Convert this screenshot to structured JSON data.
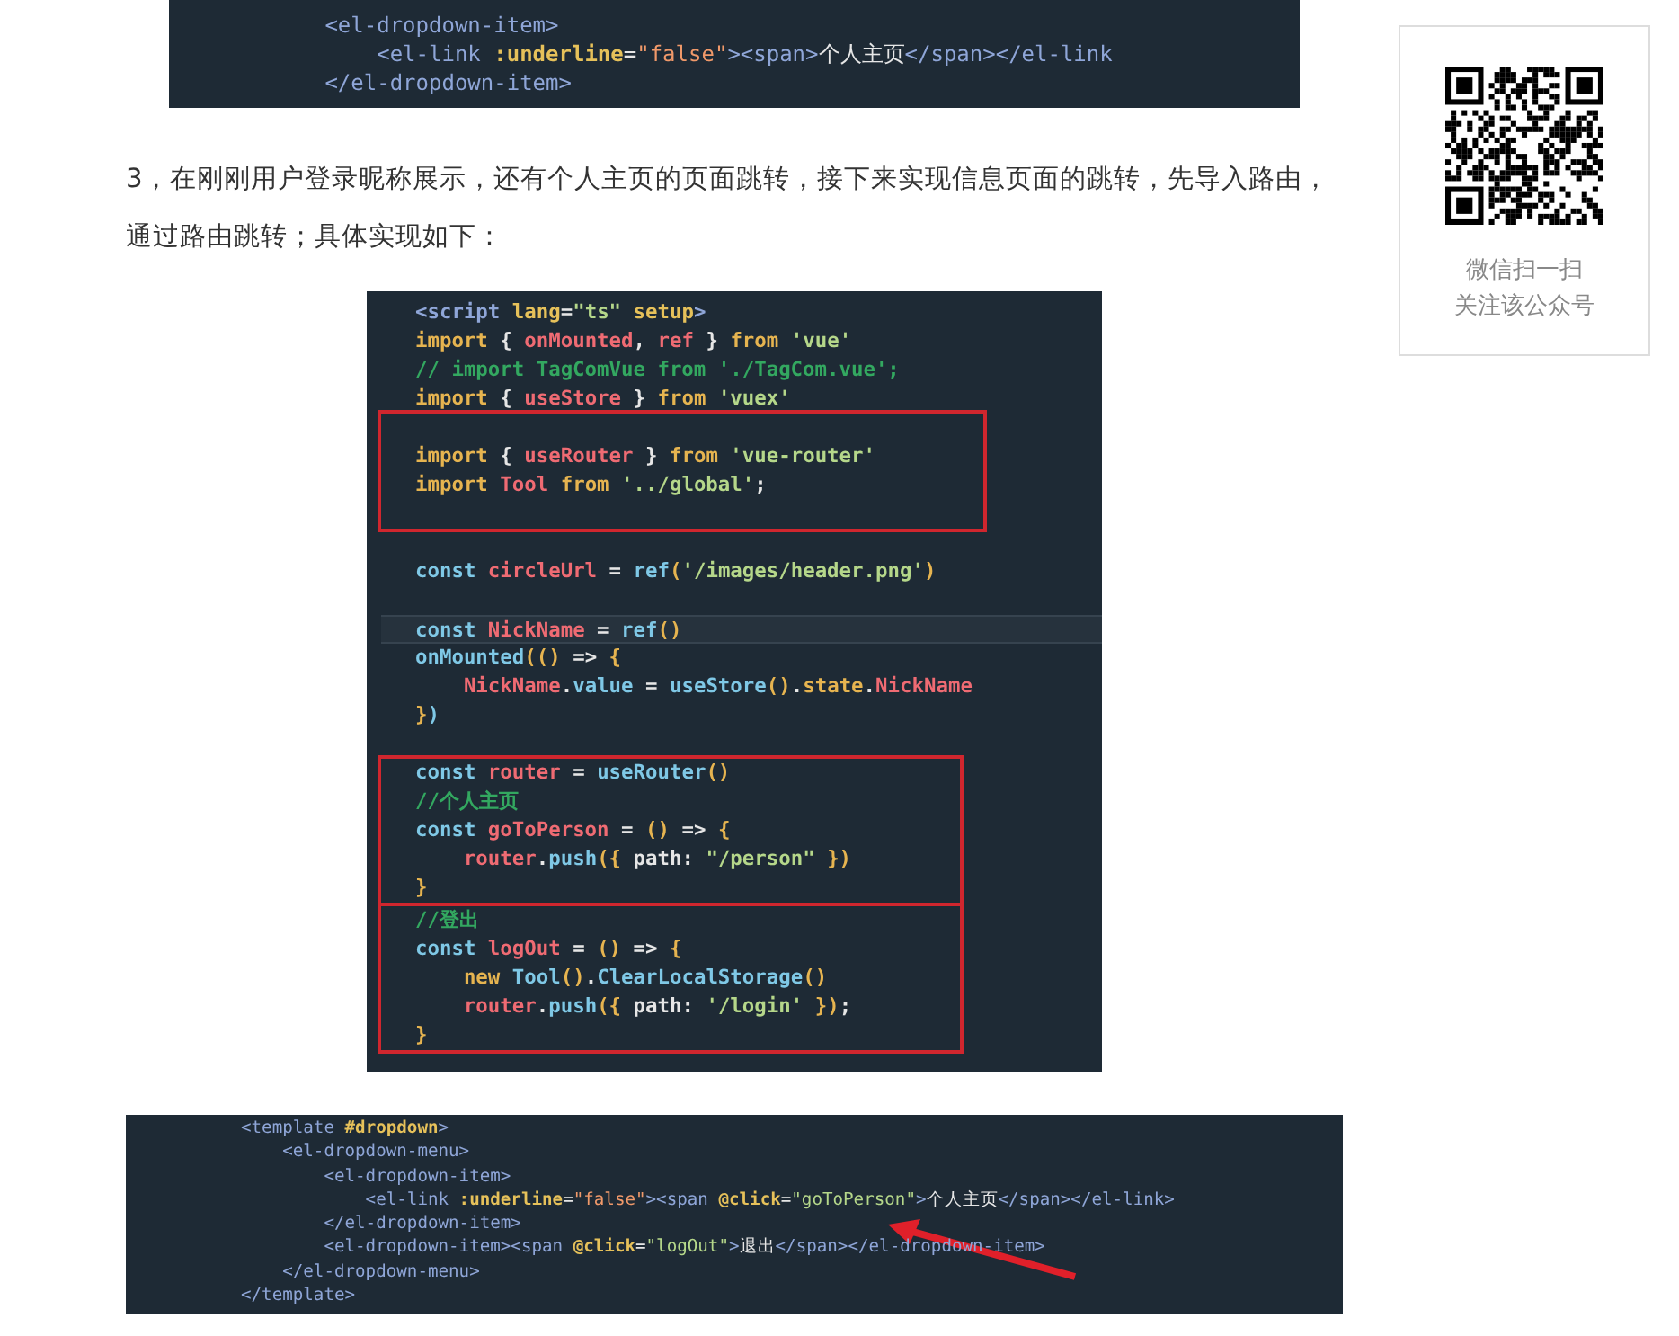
{
  "article": {
    "top_code": {
      "lines": [
        {
          "tokens": [
            {
              "kind": "t",
              "text": "            <el-dropdown-item>"
            }
          ]
        },
        {
          "tokens": [
            {
              "kind": "t",
              "text": "                <el-link "
            },
            {
              "kind": "a",
              "text": ":underline"
            },
            {
              "kind": "p",
              "text": "="
            },
            {
              "kind": "o",
              "text": "\"false\""
            },
            {
              "kind": "t",
              "text": "><span>"
            },
            {
              "kind": "p",
              "text": "个人主页"
            },
            {
              "kind": "t",
              "text": "</span></el-link"
            }
          ]
        },
        {
          "tokens": [
            {
              "kind": "t",
              "text": "            </el-dropdown-item>"
            }
          ]
        }
      ]
    },
    "paragraph": "3，在刚刚用户登录昵称展示，还有个人主页的页面跳转，接下来实现信息页面的跳转，先导入路由，通过路由跳转；具体实现如下：",
    "script_code": {
      "blocks": [
        {
          "boxed": false,
          "lines": [
            {
              "tokens": [
                {
                  "kind": "t",
                  "text": "<script "
                },
                {
                  "kind": "a",
                  "text": "lang"
                },
                {
                  "kind": "p",
                  "text": "="
                },
                {
                  "kind": "s",
                  "text": "\"ts\" "
                },
                {
                  "kind": "a",
                  "text": "setup"
                },
                {
                  "kind": "t",
                  "text": ">"
                }
              ]
            },
            {
              "tokens": [
                {
                  "kind": "k",
                  "text": "import "
                },
                {
                  "kind": "p",
                  "text": "{ "
                },
                {
                  "kind": "v",
                  "text": "onMounted"
                },
                {
                  "kind": "p",
                  "text": ", "
                },
                {
                  "kind": "v",
                  "text": "ref"
                },
                {
                  "kind": "p",
                  "text": " } "
                },
                {
                  "kind": "k",
                  "text": "from "
                },
                {
                  "kind": "s",
                  "text": "'vue'"
                }
              ]
            },
            {
              "tokens": [
                {
                  "kind": "c",
                  "text": "// import TagComVue from './TagCom.vue';"
                }
              ]
            },
            {
              "tokens": [
                {
                  "kind": "k",
                  "text": "import "
                },
                {
                  "kind": "p",
                  "text": "{ "
                },
                {
                  "kind": "v",
                  "text": "useStore"
                },
                {
                  "kind": "p",
                  "text": " } "
                },
                {
                  "kind": "k",
                  "text": "from "
                },
                {
                  "kind": "s",
                  "text": "'vuex'"
                }
              ]
            }
          ]
        },
        {
          "boxed": true,
          "lines": [
            {
              "kind": "blank"
            },
            {
              "tokens": [
                {
                  "kind": "k",
                  "text": "import "
                },
                {
                  "kind": "p",
                  "text": "{ "
                },
                {
                  "kind": "v",
                  "text": "useRouter"
                },
                {
                  "kind": "p",
                  "text": " } "
                },
                {
                  "kind": "k",
                  "text": "from "
                },
                {
                  "kind": "s",
                  "text": "'vue-router'"
                }
              ]
            },
            {
              "tokens": [
                {
                  "kind": "k",
                  "text": "import "
                },
                {
                  "kind": "v",
                  "text": "Tool "
                },
                {
                  "kind": "k",
                  "text": "from "
                },
                {
                  "kind": "s",
                  "text": "'../global'"
                },
                {
                  "kind": "p",
                  "text": ";"
                }
              ]
            },
            {
              "kind": "blank"
            }
          ]
        },
        {
          "boxed": false,
          "lines": [
            {
              "kind": "blank"
            },
            {
              "tokens": [
                {
                  "kind": "f",
                  "text": "const "
                },
                {
                  "kind": "v",
                  "text": "circleUrl"
                },
                {
                  "kind": "p",
                  "text": " = "
                },
                {
                  "kind": "f",
                  "text": "ref"
                },
                {
                  "kind": "k",
                  "text": "("
                },
                {
                  "kind": "s",
                  "text": "'/images/header.png'"
                },
                {
                  "kind": "k",
                  "text": ")"
                }
              ]
            },
            {
              "kind": "blank"
            },
            {
              "current": true,
              "tokens": [
                {
                  "kind": "f",
                  "text": "const "
                },
                {
                  "kind": "v",
                  "text": "NickName"
                },
                {
                  "kind": "p",
                  "text": " = "
                },
                {
                  "kind": "f",
                  "text": "ref"
                },
                {
                  "kind": "k",
                  "text": "()"
                }
              ]
            },
            {
              "tokens": [
                {
                  "kind": "f",
                  "text": "onMounted"
                },
                {
                  "kind": "k",
                  "text": "(() "
                },
                {
                  "kind": "p",
                  "text": "=> "
                },
                {
                  "kind": "k",
                  "text": "{"
                }
              ]
            },
            {
              "tokens": [
                {
                  "kind": "v",
                  "text": "    NickName"
                },
                {
                  "kind": "p",
                  "text": "."
                },
                {
                  "kind": "f",
                  "text": "value"
                },
                {
                  "kind": "p",
                  "text": " = "
                },
                {
                  "kind": "f",
                  "text": "useStore"
                },
                {
                  "kind": "k",
                  "text": "()"
                },
                {
                  "kind": "p",
                  "text": "."
                },
                {
                  "kind": "k",
                  "text": "state"
                },
                {
                  "kind": "p",
                  "text": "."
                },
                {
                  "kind": "v",
                  "text": "NickName"
                }
              ]
            },
            {
              "tokens": [
                {
                  "kind": "k",
                  "text": "}"
                },
                {
                  "kind": "f",
                  "text": ")"
                }
              ]
            },
            {
              "kind": "blank"
            }
          ]
        },
        {
          "boxed": true,
          "lines": [
            {
              "tokens": [
                {
                  "kind": "f",
                  "text": "const "
                },
                {
                  "kind": "v",
                  "text": "router"
                },
                {
                  "kind": "p",
                  "text": " = "
                },
                {
                  "kind": "f",
                  "text": "useRouter"
                },
                {
                  "kind": "k",
                  "text": "()"
                }
              ]
            },
            {
              "tokens": [
                {
                  "kind": "c",
                  "text": "//个人主页"
                }
              ]
            },
            {
              "tokens": [
                {
                  "kind": "f",
                  "text": "const "
                },
                {
                  "kind": "v",
                  "text": "goToPerson"
                },
                {
                  "kind": "p",
                  "text": " = "
                },
                {
                  "kind": "k",
                  "text": "() "
                },
                {
                  "kind": "p",
                  "text": "=> "
                },
                {
                  "kind": "k",
                  "text": "{"
                }
              ]
            },
            {
              "tokens": [
                {
                  "kind": "v",
                  "text": "    router"
                },
                {
                  "kind": "p",
                  "text": "."
                },
                {
                  "kind": "f",
                  "text": "push"
                },
                {
                  "kind": "k",
                  "text": "({ "
                },
                {
                  "kind": "p",
                  "text": "path: "
                },
                {
                  "kind": "s",
                  "text": "\"/person\""
                },
                {
                  "kind": "k",
                  "text": " })"
                }
              ]
            },
            {
              "tokens": [
                {
                  "kind": "k",
                  "text": "}"
                }
              ]
            }
          ]
        },
        {
          "boxed": true,
          "lines": [
            {
              "tokens": [
                {
                  "kind": "c",
                  "text": "//登出"
                }
              ]
            },
            {
              "tokens": [
                {
                  "kind": "f",
                  "text": "const "
                },
                {
                  "kind": "v",
                  "text": "logOut"
                },
                {
                  "kind": "p",
                  "text": " = "
                },
                {
                  "kind": "k",
                  "text": "() "
                },
                {
                  "kind": "p",
                  "text": "=> "
                },
                {
                  "kind": "k",
                  "text": "{"
                }
              ]
            },
            {
              "tokens": [
                {
                  "kind": "k",
                  "text": "    new "
                },
                {
                  "kind": "f",
                  "text": "Tool"
                },
                {
                  "kind": "k",
                  "text": "()"
                },
                {
                  "kind": "p",
                  "text": "."
                },
                {
                  "kind": "f",
                  "text": "ClearLocalStorage"
                },
                {
                  "kind": "k",
                  "text": "()"
                }
              ]
            },
            {
              "tokens": [
                {
                  "kind": "v",
                  "text": "    router"
                },
                {
                  "kind": "p",
                  "text": "."
                },
                {
                  "kind": "f",
                  "text": "push"
                },
                {
                  "kind": "k",
                  "text": "({ "
                },
                {
                  "kind": "p",
                  "text": "path: "
                },
                {
                  "kind": "s",
                  "text": "'/login'"
                },
                {
                  "kind": "k",
                  "text": " })"
                },
                {
                  "kind": "p",
                  "text": ";"
                }
              ]
            },
            {
              "tokens": [
                {
                  "kind": "k",
                  "text": "}"
                }
              ]
            }
          ]
        }
      ]
    },
    "template_code": {
      "lines": [
        {
          "tokens": [
            {
              "kind": "t",
              "text": "<template "
            },
            {
              "kind": "a",
              "text": "#dropdown"
            },
            {
              "kind": "t",
              "text": ">"
            }
          ]
        },
        {
          "tokens": [
            {
              "kind": "t",
              "text": "    <el-dropdown-menu>"
            }
          ]
        },
        {
          "tokens": [
            {
              "kind": "t",
              "text": "        <el-dropdown-item>"
            }
          ]
        },
        {
          "tokens": [
            {
              "kind": "t",
              "text": "            <el-link "
            },
            {
              "kind": "a",
              "text": ":underline"
            },
            {
              "kind": "p",
              "text": "="
            },
            {
              "kind": "o",
              "text": "\"false\""
            },
            {
              "kind": "t",
              "text": "><span "
            },
            {
              "kind": "a",
              "text": "@click"
            },
            {
              "kind": "p",
              "text": "="
            },
            {
              "kind": "s",
              "text": "\"goToPerson\""
            },
            {
              "kind": "t",
              "text": ">"
            },
            {
              "kind": "p",
              "text": "个人主页"
            },
            {
              "kind": "t",
              "text": "</span></el-link>"
            }
          ]
        },
        {
          "tokens": [
            {
              "kind": "t",
              "text": "        </el-dropdown-item>"
            }
          ]
        },
        {
          "tokens": [
            {
              "kind": "t",
              "text": "        <el-dropdown-item><span "
            },
            {
              "kind": "a",
              "text": "@click"
            },
            {
              "kind": "p",
              "text": "="
            },
            {
              "kind": "s",
              "text": "\"logOut\""
            },
            {
              "kind": "t",
              "text": ">"
            },
            {
              "kind": "p",
              "text": "退出"
            },
            {
              "kind": "t",
              "text": "</span></el-dropdown-item>"
            }
          ]
        },
        {
          "tokens": [
            {
              "kind": "t",
              "text": "    </el-dropdown-menu>"
            }
          ]
        },
        {
          "tokens": [
            {
              "kind": "t",
              "text": "</template>"
            }
          ]
        }
      ]
    }
  },
  "sidebar": {
    "qr_caption": [
      "微信扫一扫",
      "关注该公众号"
    ]
  }
}
